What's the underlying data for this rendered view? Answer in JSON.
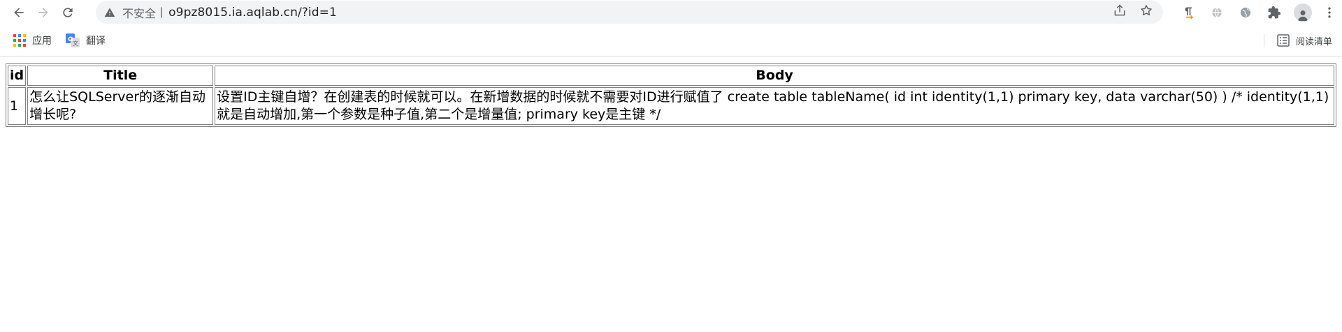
{
  "browser": {
    "omnibox": {
      "security_label": "不安全",
      "separator": "|",
      "url": "o9pz8015.ia.aqlab.cn/?id=1"
    },
    "bookmarks": [
      {
        "label": "应用",
        "icon": "apps-grid-icon"
      },
      {
        "label": "翻译",
        "icon": "google-translate-icon"
      }
    ],
    "reading_list_label": "阅读清单"
  },
  "table": {
    "headers": [
      "id",
      "Title",
      "Body"
    ],
    "rows": [
      {
        "id": "1",
        "title": "怎么让SQLServer的逐渐自动增长呢?",
        "body": "设置ID主键自增？在创建表的时候就可以。在新增数据的时候就不需要对ID进行赋值了 create table tableName( id int identity(1,1) primary key, data varchar(50) ) /* identity(1,1)就是自动增加,第一个参数是种子值,第二个是增量值; primary key是主键 */"
      }
    ]
  },
  "colors": {
    "toolbar_bg": "#ffffff",
    "omnibox_bg": "#f1f3f4",
    "table_border": "#808080",
    "extension_accent": "#f29900"
  }
}
